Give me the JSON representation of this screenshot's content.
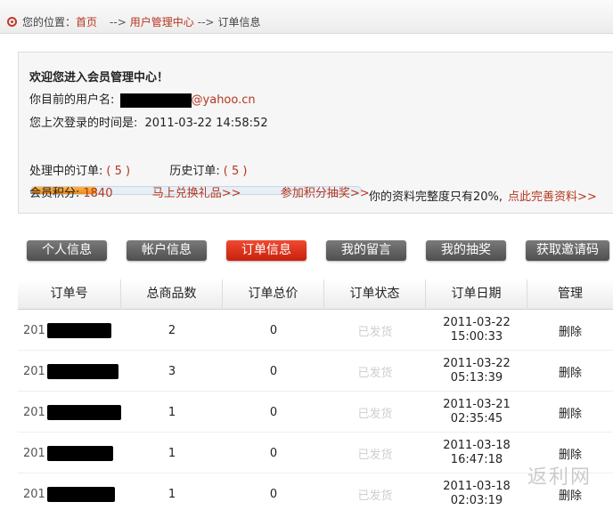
{
  "breadcrumb": {
    "label": "您的位置：",
    "home": "首页",
    "sep1": "-->",
    "center": "用户管理中心",
    "sep2": "-->",
    "current": "订单信息"
  },
  "member": {
    "welcome": "欢迎您进入会员管理中心！",
    "username_label": "你目前的用户名:",
    "username_domain": "@yahoo.cn",
    "last_login_label": "您上次登录的时间是:",
    "last_login": "2011-03-22 14:58:52",
    "profile_progress_percent": 20,
    "profile_note": "你的资料完整度只有20%,",
    "profile_link": "点此完善资料>>",
    "processing_label": "处理中的订单:",
    "processing_count": "( 5 )",
    "history_label": "历史订单:",
    "history_count": "( 5 )",
    "points_label": "会员积分:",
    "points": "1840",
    "redeem_link": "马上兑换礼品>>",
    "lottery_link": "参加积分抽奖>>"
  },
  "tabs": [
    {
      "label": "个人信息",
      "active": false
    },
    {
      "label": "帐户信息",
      "active": false
    },
    {
      "label": "订单信息",
      "active": true
    },
    {
      "label": "我的留言",
      "active": false
    },
    {
      "label": "我的抽奖",
      "active": false
    },
    {
      "label": "获取邀请码",
      "active": false
    }
  ],
  "orders": {
    "columns": [
      "订单号",
      "总商品数",
      "订单总价",
      "订单状态",
      "订单日期",
      "管理"
    ],
    "rows": [
      {
        "id_prefix": "201",
        "items": "2",
        "total": "0",
        "status": "已发货",
        "date": "2011-03-22",
        "time": "15:00:33",
        "action": "删除"
      },
      {
        "id_prefix": "201",
        "items": "3",
        "total": "0",
        "status": "已发货",
        "date": "2011-03-22",
        "time": "05:13:39",
        "action": "删除"
      },
      {
        "id_prefix": "201",
        "items": "1",
        "total": "0",
        "status": "已发货",
        "date": "2011-03-21",
        "time": "02:35:45",
        "action": "删除"
      },
      {
        "id_prefix": "201",
        "items": "1",
        "total": "0",
        "status": "已发货",
        "date": "2011-03-18",
        "time": "16:47:18",
        "action": "删除"
      },
      {
        "id_prefix": "201",
        "items": "1",
        "total": "0",
        "status": "已发货",
        "date": "2011-03-18",
        "time": "02:03:19",
        "action": "删除"
      }
    ]
  },
  "watermark": "返利网",
  "colors": {
    "accent": "#b5361f",
    "active_tab": "#e0361f",
    "tab": "#5f5f5f"
  }
}
